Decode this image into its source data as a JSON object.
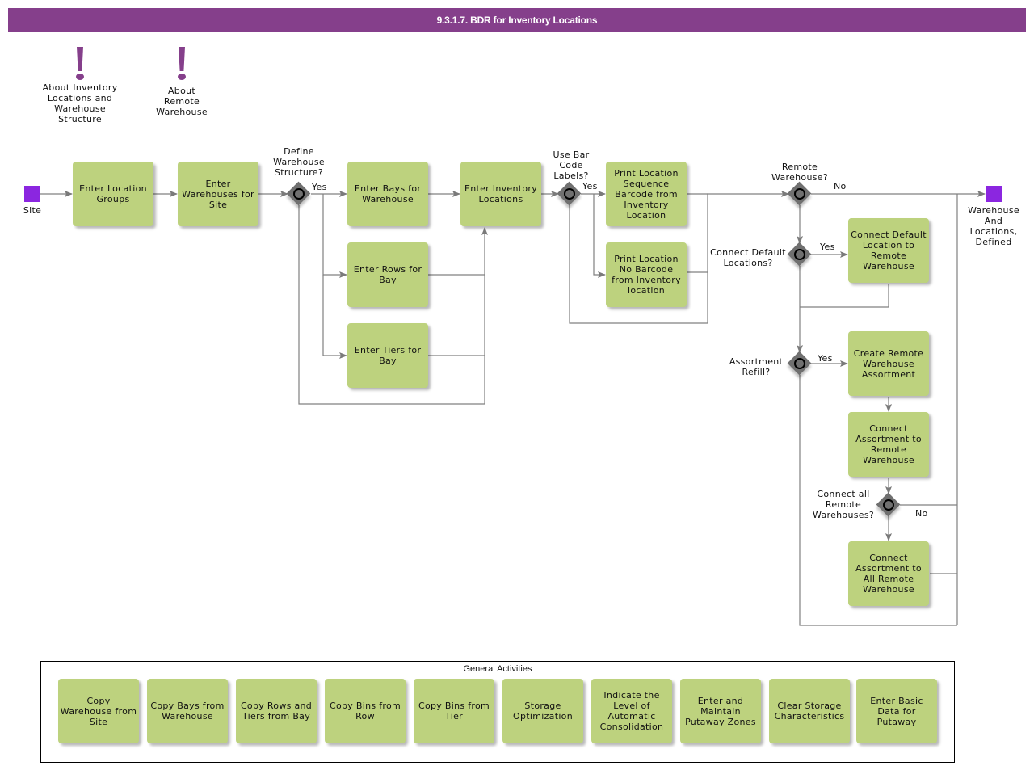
{
  "header": {
    "title": "9.3.1.7. BDR for Inventory Locations"
  },
  "annotations": [
    {
      "id": "about-inventory",
      "text": "About Inventory Locations and Warehouse Structure",
      "icon": "exclamation-icon"
    },
    {
      "id": "about-remote",
      "text": "About Remote Warehouse",
      "icon": "exclamation-icon"
    }
  ],
  "events": {
    "start": "Site",
    "end": "Warehouse And Locations, Defined"
  },
  "tasks": {
    "enter_location_groups": "Enter Location Groups",
    "enter_warehouses": "Enter Warehouses for Site",
    "enter_bays": "Enter Bays for Warehouse",
    "enter_rows": "Enter Rows for Bay",
    "enter_tiers": "Enter Tiers for Bay",
    "enter_inventory_locations": "Enter Inventory Locations",
    "print_sequence_barcode": "Print Location Sequence Barcode from Inventory Location",
    "print_no_barcode": "Print Location No Barcode from Inventory location",
    "connect_default_location": "Connect Default Location to Remote Warehouse",
    "create_assortment": "Create Remote Warehouse Assortment",
    "connect_assortment": "Connect Assortment to Remote Warehouse",
    "connect_assortment_all": "Connect Assortment to All Remote Warehouse"
  },
  "gateways": {
    "define_structure": "Define Warehouse Structure?",
    "use_barcode": "Use Bar Code Labels?",
    "remote_warehouse": "Remote Warehouse?",
    "connect_default": "Connect Default Locations?",
    "assortment_refill": "Assortment Refill?",
    "connect_all": "Connect all Remote Warehouses?"
  },
  "flow_labels": {
    "yes": "Yes",
    "no": "No"
  },
  "general_activities": {
    "title": "General Activities",
    "items": [
      "Copy Warehouse from Site",
      "Copy Bays from Warehouse",
      "Copy Rows and Tiers from Bay",
      "Copy Bins from Row",
      "Copy Bins from Tier",
      "Storage Optimization",
      "Indicate the Level of Automatic Consolidation",
      "Enter and Maintain Putaway Zones",
      "Clear Storage Characteristics",
      "Enter Basic Data for Putaway"
    ]
  },
  "colors": {
    "header": "#853f8b",
    "task": "#bdd27e",
    "event": "#8b26e0",
    "gateway": "#707070",
    "connector": "#808080"
  }
}
